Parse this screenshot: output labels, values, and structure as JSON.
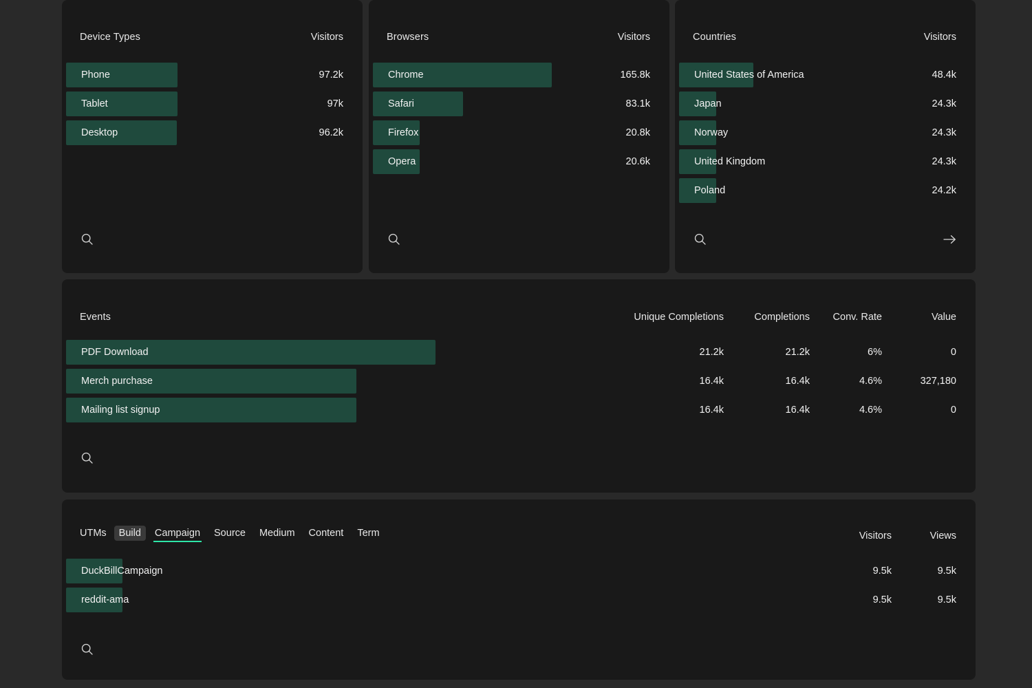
{
  "theme": {
    "page_bg": "#292929",
    "card_bg": "#191919",
    "bar_green": "#1f4a3d",
    "accent_underline": "#2ee6a8",
    "text": "#f1f1f1"
  },
  "cards": {
    "devices": {
      "title": "Device Types",
      "metric_label": "Visitors",
      "rows": [
        {
          "label": "Phone",
          "value": "97.2k",
          "bar_pct": 100
        },
        {
          "label": "Tablet",
          "value": "97k",
          "bar_pct": 99.8
        },
        {
          "label": "Desktop",
          "value": "96.2k",
          "bar_pct": 99
        }
      ],
      "search_icon": "search-icon"
    },
    "browsers": {
      "title": "Browsers",
      "metric_label": "Visitors",
      "rows": [
        {
          "label": "Chrome",
          "value": "165.8k",
          "bar_pct": 100
        },
        {
          "label": "Safari",
          "value": "83.1k",
          "bar_pct": 50.1
        },
        {
          "label": "Firefox",
          "value": "20.8k",
          "bar_pct": 12.5
        },
        {
          "label": "Opera",
          "value": "20.6k",
          "bar_pct": 12.4
        }
      ],
      "search_icon": "search-icon"
    },
    "countries": {
      "title": "Countries",
      "metric_label": "Visitors",
      "rows": [
        {
          "label": "United States of America",
          "value": "48.4k",
          "bar_pct": 100
        },
        {
          "label": "Japan",
          "value": "24.3k",
          "bar_pct": 50.2
        },
        {
          "label": "Norway",
          "value": "24.3k",
          "bar_pct": 50.2
        },
        {
          "label": "United Kingdom",
          "value": "24.3k",
          "bar_pct": 50.2
        },
        {
          "label": "Poland",
          "value": "24.2k",
          "bar_pct": 50
        }
      ],
      "search_icon": "search-icon",
      "details_icon": "arrow-right-icon"
    },
    "events": {
      "title": "Events",
      "columns": [
        "Unique Completions",
        "Completions",
        "Conv. Rate",
        "Value"
      ],
      "rows": [
        {
          "label": "PDF Download",
          "unique_completions": "21.2k",
          "completions": "21.2k",
          "conv_rate": "6%",
          "value": "0",
          "bar_pct": 100
        },
        {
          "label": "Merch purchase",
          "unique_completions": "16.4k",
          "completions": "16.4k",
          "conv_rate": "4.6%",
          "value": "327,180",
          "bar_pct": 78.4
        },
        {
          "label": "Mailing list signup",
          "unique_completions": "16.4k",
          "completions": "16.4k",
          "conv_rate": "4.6%",
          "value": "0",
          "bar_pct": 78.4
        }
      ],
      "search_icon": "search-icon"
    },
    "utms": {
      "label": "UTMs",
      "build_button": "Build",
      "tabs": [
        "Campaign",
        "Source",
        "Medium",
        "Content",
        "Term"
      ],
      "active_tab": "Campaign",
      "columns": [
        "Visitors",
        "Views"
      ],
      "rows": [
        {
          "label": "DuckBillCampaign",
          "visitors": "9.5k",
          "views": "9.5k",
          "bar_pct": 100
        },
        {
          "label": "reddit-ama",
          "visitors": "9.5k",
          "views": "9.5k",
          "bar_pct": 100
        }
      ],
      "search_icon": "search-icon"
    }
  },
  "chart_data": [
    {
      "type": "bar",
      "title": "Device Types",
      "xlabel": "",
      "ylabel": "Visitors",
      "orientation": "horizontal",
      "categories": [
        "Phone",
        "Tablet",
        "Desktop"
      ],
      "values": [
        97200,
        97000,
        96200
      ],
      "value_labels": [
        "97.2k",
        "97k",
        "96.2k"
      ],
      "grid": false,
      "legend": "none"
    },
    {
      "type": "bar",
      "title": "Browsers",
      "xlabel": "",
      "ylabel": "Visitors",
      "orientation": "horizontal",
      "categories": [
        "Chrome",
        "Safari",
        "Firefox",
        "Opera"
      ],
      "values": [
        165800,
        83100,
        20800,
        20600
      ],
      "value_labels": [
        "165.8k",
        "83.1k",
        "20.8k",
        "20.6k"
      ],
      "grid": false,
      "legend": "none"
    },
    {
      "type": "bar",
      "title": "Countries",
      "xlabel": "",
      "ylabel": "Visitors",
      "orientation": "horizontal",
      "categories": [
        "United States of America",
        "Japan",
        "Norway",
        "United Kingdom",
        "Poland"
      ],
      "values": [
        48400,
        24300,
        24300,
        24300,
        24200
      ],
      "value_labels": [
        "48.4k",
        "24.3k",
        "24.3k",
        "24.3k",
        "24.2k"
      ],
      "grid": false,
      "legend": "none"
    },
    {
      "type": "table",
      "title": "Events",
      "columns": [
        "Events",
        "Unique Completions",
        "Completions",
        "Conv. Rate",
        "Value"
      ],
      "rows": [
        [
          "PDF Download",
          "21.2k",
          "21.2k",
          "6%",
          "0"
        ],
        [
          "Merch purchase",
          "16.4k",
          "16.4k",
          "4.6%",
          "327,180"
        ],
        [
          "Mailing list signup",
          "16.4k",
          "16.4k",
          "4.6%",
          "0"
        ]
      ],
      "bar_values": [
        21200,
        16400,
        16400
      ]
    },
    {
      "type": "table",
      "title": "UTMs - Campaign",
      "columns": [
        "Campaign",
        "Visitors",
        "Views"
      ],
      "rows": [
        [
          "DuckBillCampaign",
          "9.5k",
          "9.5k"
        ],
        [
          "reddit-ama",
          "9.5k",
          "9.5k"
        ]
      ],
      "bar_values": [
        9500,
        9500
      ]
    }
  ]
}
